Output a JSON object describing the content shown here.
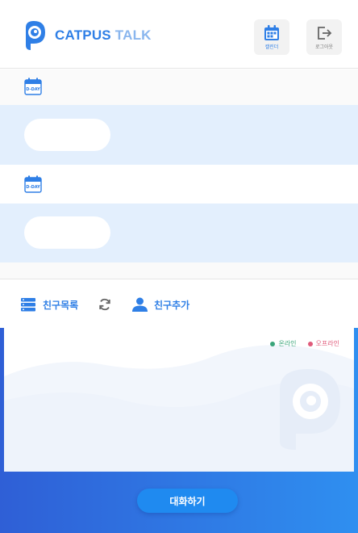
{
  "header": {
    "logo_primary": "CATPUS",
    "logo_secondary": " TALK",
    "calendar_label": "캘린더",
    "logout_label": "로그아웃"
  },
  "dday_icon_text": "D-DAY",
  "tabs": {
    "friend_list": "친구목록",
    "add_friend": "친구추가"
  },
  "legend": {
    "online": "온라인",
    "offline": "오프라인"
  },
  "chat_button": "대화하기",
  "colors": {
    "brand_blue": "#2f7fe6",
    "highlight_row": "#e3effd",
    "online": "#3aa57a",
    "offline": "#e05a7a"
  }
}
